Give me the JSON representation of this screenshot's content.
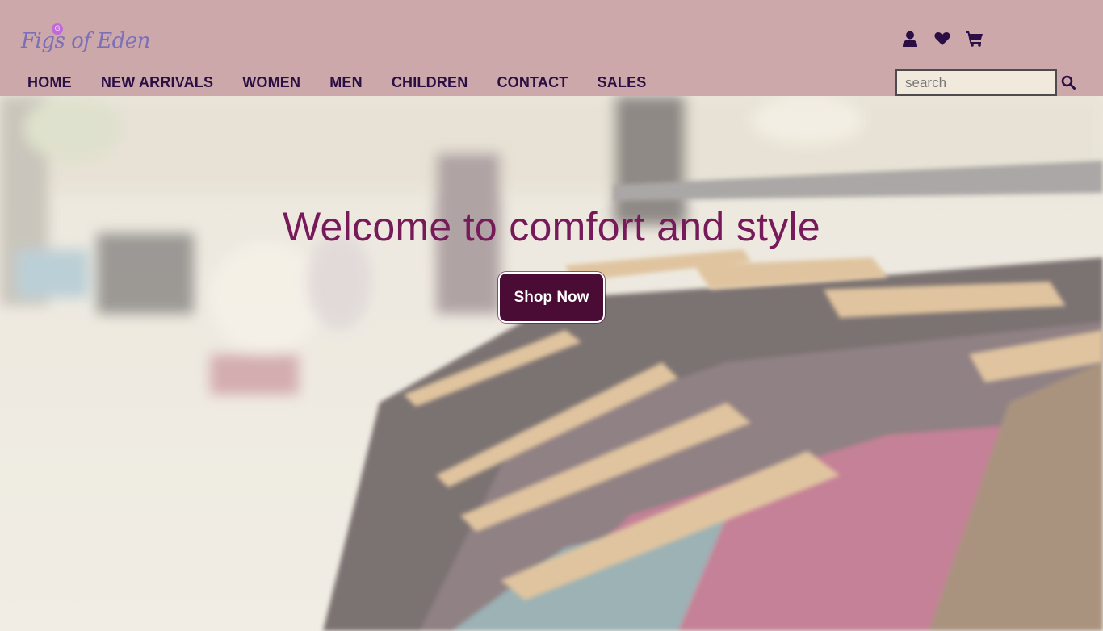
{
  "brand": {
    "logo_text": "Figs of Eden",
    "logo_badge": "G"
  },
  "header_icons": [
    "user-icon",
    "heart-icon",
    "cart-icon"
  ],
  "nav": {
    "items": [
      "HOME",
      "NEW ARRIVALS",
      "WOMEN",
      "MEN",
      "CHILDREN",
      "CONTACT",
      "SALES"
    ]
  },
  "search": {
    "placeholder": "search",
    "value": ""
  },
  "hero": {
    "title": "Welcome to comfort and style",
    "cta_label": "Shop Now"
  },
  "colors": {
    "header_bg": "#cca8ab",
    "nav_text": "#2b0f44",
    "title": "#761a5a",
    "cta_bg": "#4a0c34"
  }
}
